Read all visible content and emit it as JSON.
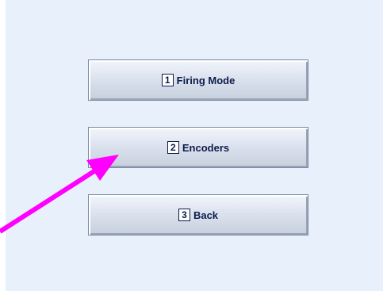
{
  "menu": {
    "items": [
      {
        "key": "1",
        "label": "Firing Mode"
      },
      {
        "key": "2",
        "label": "Encoders"
      },
      {
        "key": "3",
        "label": "Back"
      }
    ]
  },
  "colors": {
    "background": "#e8f0fb",
    "button_text": "#0d1b4a",
    "annotation_arrow": "#ff00ff"
  },
  "icons": {
    "annotation": "arrow-pointer-icon"
  }
}
